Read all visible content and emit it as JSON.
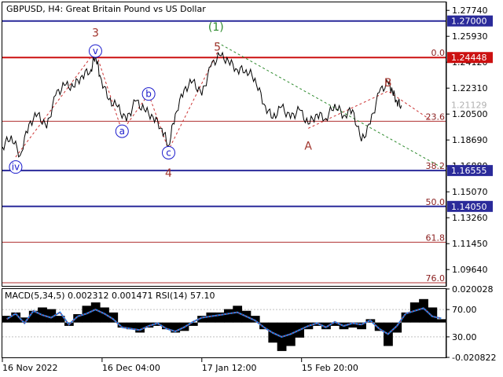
{
  "chart_data": {
    "type": "line",
    "title": "GBPUSD, H4:  Great Britain Pound vs US Dollar",
    "symbol": "GBPUSD",
    "timeframe": "H4",
    "description": "Great Britain Pound vs US Dollar",
    "price_axis": {
      "ylim": [
        1.085,
        1.283
      ],
      "ticks": [
        "1.27740",
        "1.25930",
        "1.24120",
        "1.22310",
        "1.20500",
        "1.18690",
        "1.16880",
        "1.15070",
        "1.13260",
        "1.11450",
        "1.09640"
      ],
      "tick_values": [
        1.2774,
        1.2593,
        1.2412,
        1.2231,
        1.205,
        1.1869,
        1.1688,
        1.1507,
        1.1326,
        1.1145,
        1.0964
      ]
    },
    "time_axis": {
      "labels": [
        "16 Nov 2022",
        "16 Dec 04:00",
        "17 Jan 12:00",
        "15 Feb 20:00"
      ],
      "label_index": [
        0,
        0.225,
        0.45,
        0.675
      ]
    },
    "price_levels": [
      {
        "label": "1.27000",
        "value": 1.27,
        "color": "#2a2a9a"
      },
      {
        "label": "1.24448",
        "value": 1.24448,
        "color": "#cc1111"
      },
      {
        "label": "1.21129",
        "value": 1.21129,
        "color": "#c0c0c0"
      },
      {
        "label": "1.16555",
        "value": 1.16555,
        "color": "#2a2a9a"
      },
      {
        "label": "1.14050",
        "value": 1.1405,
        "color": "#2a2a9a"
      }
    ],
    "fib_levels": [
      {
        "label": "0.0",
        "value": 1.24448
      },
      {
        "label": "23.6",
        "value": 1.2
      },
      {
        "label": "38.2",
        "value": 1.16555
      },
      {
        "label": "50.0",
        "value": 1.1405
      },
      {
        "label": "61.8",
        "value": 1.1155
      },
      {
        "label": "76.0",
        "value": 1.0872
      }
    ],
    "wave_labels": [
      {
        "text": "3",
        "t": 0.21,
        "price": 1.262,
        "style": "plain",
        "color": "#a0332b"
      },
      {
        "text": "4",
        "t": 0.375,
        "price": 1.164,
        "style": "plain",
        "color": "#a0332b"
      },
      {
        "text": "5",
        "t": 0.485,
        "price": 1.252,
        "style": "plain",
        "color": "#a0332b"
      },
      {
        "text": "(1)",
        "t": 0.482,
        "price": 1.266,
        "style": "plain",
        "color": "#2e8b2e"
      },
      {
        "text": "A",
        "t": 0.69,
        "price": 1.183,
        "style": "plain",
        "color": "#a0332b"
      },
      {
        "text": "B",
        "t": 0.87,
        "price": 1.227,
        "style": "plain",
        "color": "#a0332b"
      },
      {
        "text": "iv",
        "t": 0.03,
        "price": 1.168,
        "style": "circle",
        "color": "#1a1acc"
      },
      {
        "text": "v",
        "t": 0.21,
        "price": 1.249,
        "style": "circle",
        "color": "#1a1acc"
      },
      {
        "text": "a",
        "t": 0.27,
        "price": 1.193,
        "style": "circle",
        "color": "#1a1acc"
      },
      {
        "text": "b",
        "t": 0.33,
        "price": 1.219,
        "style": "circle",
        "color": "#1a1acc"
      },
      {
        "text": "c",
        "t": 0.375,
        "price": 1.178,
        "style": "circle",
        "color": "#1a1acc"
      }
    ],
    "price_series": {
      "t": [
        0.0,
        0.02,
        0.04,
        0.06,
        0.08,
        0.1,
        0.12,
        0.14,
        0.16,
        0.18,
        0.2,
        0.21,
        0.22,
        0.24,
        0.26,
        0.28,
        0.3,
        0.32,
        0.34,
        0.36,
        0.375,
        0.39,
        0.41,
        0.43,
        0.45,
        0.47,
        0.49,
        0.51,
        0.53,
        0.55,
        0.57,
        0.59,
        0.61,
        0.63,
        0.65,
        0.67,
        0.69,
        0.71,
        0.73,
        0.75,
        0.77,
        0.79,
        0.81,
        0.83,
        0.85,
        0.87,
        0.88,
        0.89,
        0.9
      ],
      "price": [
        1.182,
        1.19,
        1.176,
        1.198,
        1.205,
        1.195,
        1.218,
        1.225,
        1.224,
        1.232,
        1.236,
        1.247,
        1.232,
        1.215,
        1.21,
        1.2,
        1.214,
        1.208,
        1.203,
        1.195,
        1.183,
        1.205,
        1.222,
        1.228,
        1.218,
        1.238,
        1.246,
        1.242,
        1.236,
        1.236,
        1.23,
        1.212,
        1.202,
        1.21,
        1.202,
        1.208,
        1.198,
        1.205,
        1.202,
        1.212,
        1.204,
        1.208,
        1.186,
        1.198,
        1.22,
        1.227,
        1.221,
        1.214,
        1.211
      ]
    },
    "indicator": {
      "label": "MACD(5,34,5) 0.002312 0.001471 RSI(14) 57.10",
      "ticks": [
        "0.020028",
        "70.00",
        "30.00",
        "-0.020822"
      ],
      "ylim": [
        -0.0208,
        0.02
      ],
      "histogram": [
        0.004,
        0.006,
        0.003,
        0.007,
        0.009,
        0.008,
        0.004,
        -0.002,
        0.005,
        0.01,
        0.012,
        0.009,
        0.006,
        -0.003,
        -0.004,
        -0.006,
        -0.003,
        -0.002,
        -0.004,
        -0.006,
        -0.005,
        -0.002,
        0.004,
        0.006,
        0.006,
        0.008,
        0.01,
        0.007,
        0.004,
        -0.004,
        -0.012,
        -0.017,
        -0.014,
        -0.009,
        -0.004,
        -0.002,
        -0.004,
        -0.002,
        -0.004,
        -0.003,
        -0.004,
        0.002,
        -0.005,
        -0.014,
        -0.006,
        0.006,
        0.012,
        0.014,
        0.009,
        0.002
      ],
      "rsi": [
        56,
        64,
        50,
        68,
        62,
        58,
        66,
        48,
        60,
        64,
        70,
        64,
        56,
        44,
        42,
        40,
        46,
        50,
        42,
        38,
        44,
        52,
        58,
        60,
        62,
        64,
        66,
        60,
        54,
        44,
        36,
        30,
        34,
        40,
        46,
        50,
        44,
        52,
        46,
        50,
        48,
        54,
        42,
        34,
        46,
        64,
        68,
        72,
        60,
        57
      ]
    }
  }
}
